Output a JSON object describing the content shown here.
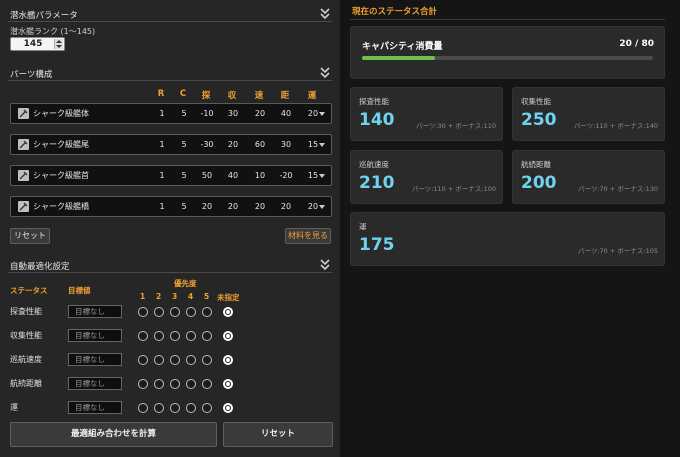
{
  "params": {
    "title": "潜水艦パラメータ",
    "rank_label": "潜水艦ランク (1～145)",
    "rank_value": "145"
  },
  "parts": {
    "title": "パーツ構成",
    "headers": [
      "R",
      "C",
      "探",
      "収",
      "速",
      "距",
      "運"
    ],
    "rows": [
      {
        "name": "シャーク級艦体",
        "values": [
          "1",
          "5",
          "-10",
          "30",
          "20",
          "40",
          "20"
        ]
      },
      {
        "name": "シャーク級艦尾",
        "values": [
          "1",
          "5",
          "-30",
          "20",
          "60",
          "30",
          "15"
        ]
      },
      {
        "name": "シャーク級艦首",
        "values": [
          "1",
          "5",
          "50",
          "40",
          "10",
          "-20",
          "15"
        ]
      },
      {
        "name": "シャーク級艦橋",
        "values": [
          "1",
          "5",
          "20",
          "20",
          "20",
          "20",
          "20"
        ]
      }
    ],
    "reset_label": "リセット",
    "materials_label": "材料を見る"
  },
  "auto": {
    "title": "自動最適化設定",
    "col_status": "ステータス",
    "col_target": "目標値",
    "col_priority": "優先度",
    "priority_labels": [
      "1",
      "2",
      "3",
      "4",
      "5",
      "未指定"
    ],
    "target_placeholder": "目標なし",
    "rows": [
      {
        "name": "探査性能",
        "selected": 5
      },
      {
        "name": "収集性能",
        "selected": 5
      },
      {
        "name": "巡航速度",
        "selected": 5
      },
      {
        "name": "航続距離",
        "selected": 5
      },
      {
        "name": "運",
        "selected": 5
      }
    ],
    "compute_label": "最適組み合わせを計算",
    "reset_label": "リセット"
  },
  "summary": {
    "title": "現在のステータス合計",
    "capacity": {
      "label": "キャパシティ消費量",
      "text": "20 / 80",
      "used": 20,
      "max": 80
    },
    "stats": [
      {
        "label": "探査性能",
        "value": "140",
        "breakdown": "パーツ:30 + ボーナス:110"
      },
      {
        "label": "収集性能",
        "value": "250",
        "breakdown": "パーツ:110 + ボーナス:140"
      },
      {
        "label": "巡航速度",
        "value": "210",
        "breakdown": "パーツ:110 + ボーナス:100"
      },
      {
        "label": "航続距離",
        "value": "200",
        "breakdown": "パーツ:70 + ボーナス:130"
      },
      {
        "label": "運",
        "value": "175",
        "breakdown": "パーツ:70 + ボーナス:105"
      }
    ]
  },
  "colors": {
    "accent": "#f0a030",
    "value": "#6fd3ef",
    "progress": "#6fbf4f"
  }
}
